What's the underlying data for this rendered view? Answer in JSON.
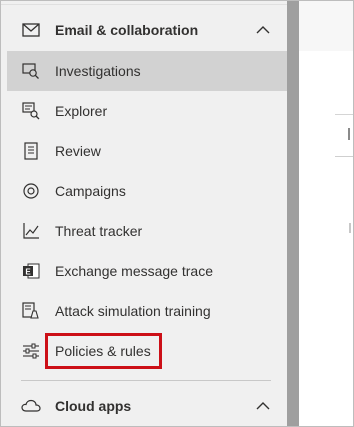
{
  "nav": {
    "section_email": "Email & collaboration",
    "items": [
      {
        "label": "Investigations",
        "icon": "investigation-icon"
      },
      {
        "label": "Explorer",
        "icon": "explorer-icon"
      },
      {
        "label": "Review",
        "icon": "review-icon"
      },
      {
        "label": "Campaigns",
        "icon": "campaigns-icon"
      },
      {
        "label": "Threat tracker",
        "icon": "threat-tracker-icon"
      },
      {
        "label": "Exchange message trace",
        "icon": "exchange-icon"
      },
      {
        "label": "Attack simulation training",
        "icon": "attack-simulation-icon"
      },
      {
        "label": "Policies & rules",
        "icon": "policies-icon"
      }
    ],
    "section_cloud": "Cloud apps"
  },
  "colors": {
    "highlight": "#cc0f17",
    "selected_bg": "#d2d2d2",
    "nav_bg": "#f0f0f0"
  }
}
